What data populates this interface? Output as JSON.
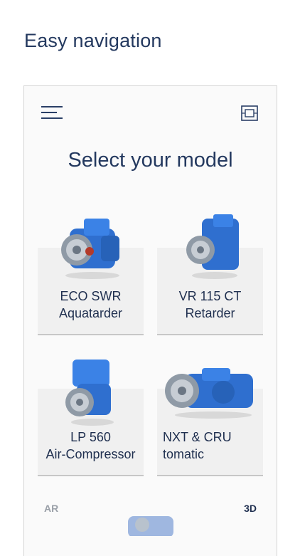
{
  "headline": "Easy navigation",
  "icons": {
    "menu": "hamburger-menu-icon",
    "view": "view-toggle-icon"
  },
  "title": "Select your model",
  "models": [
    {
      "line1": "ECO SWR",
      "line2": "Aquatarder"
    },
    {
      "line1": "VR 115 CT",
      "line2": "Retarder"
    },
    {
      "line1": "LP 560",
      "line2": "Air-Compressor"
    },
    {
      "line1": "NXT & CRU",
      "line2": "tomatic"
    }
  ],
  "bottom": {
    "left": "AR",
    "right": "3D"
  },
  "colors": {
    "accent": "#24395f",
    "part_blue": "#2f6fcf"
  }
}
